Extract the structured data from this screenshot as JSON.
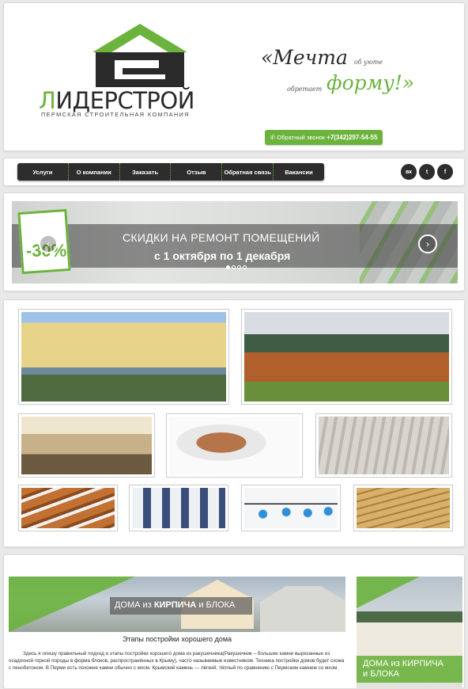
{
  "brand": {
    "name_first": "Л",
    "name_rest": "ИДЕРСТРОЙ",
    "tagline": "ПЕРМСКАЯ СТРОИТЕЛЬНАЯ КОМПАНИЯ",
    "accent": "#6cb33e",
    "dark": "#2d2d2d"
  },
  "slogan": {
    "word1": "«Мечта",
    "small1": "об уюте",
    "small2": "обретает",
    "word2": "форму!»"
  },
  "callback": {
    "label": "Обратный звонок",
    "phone": "+7(342)297-54-55",
    "icon": "phone-icon"
  },
  "menu": {
    "items": [
      "Услуги",
      "О компании",
      "Заказать",
      "Отзыв",
      "Обратная связь",
      "Вакансии"
    ]
  },
  "social": {
    "vk": "вк",
    "twitter": "t",
    "facebook": "f"
  },
  "slider": {
    "badge": "-30%",
    "line1": "СКИДКИ НА РЕМОНТ ПОМЕЩЕНИЙ",
    "line2": "с 1 октября по 1 декабря",
    "prev_icon": "chevron-left-icon",
    "next_icon": "chevron-right-icon",
    "prev_symbol": "‹",
    "next_symbol": "›",
    "active_slide": 1,
    "slide_count": 4
  },
  "gallery": {
    "items": [
      "facade-photo",
      "log-house-photo",
      "interior-photo",
      "roof-model-photo",
      "worker-photo",
      "pipes-photo",
      "siding-photo",
      "bulbs-photo",
      "timber-photo"
    ]
  },
  "article": {
    "banner_part1": "ДОМА из",
    "banner_part2": "КИРПИЧА",
    "banner_part3": "и БЛОКА",
    "title": "Этапы постройки хорошего дома",
    "text": "Здесь я опишу правильный подход и этапы постройки хорошего дома из ракушечника(Ракушечник – большие камни вырезанные из осадочной горной породы в форма блоков, распространённых в Крыму), часто называемые известняком. Техника постройки домов будет схожа с пенобетоном. В Перми есть похожие камни обычно с мхом. Крымский камень — лёгкий, тёплый по сравнению с Пермским камнем со мхом."
  },
  "side_banner": {
    "line1": "ДОМА из КИРПИЧА",
    "line2": "и БЛОКА"
  }
}
